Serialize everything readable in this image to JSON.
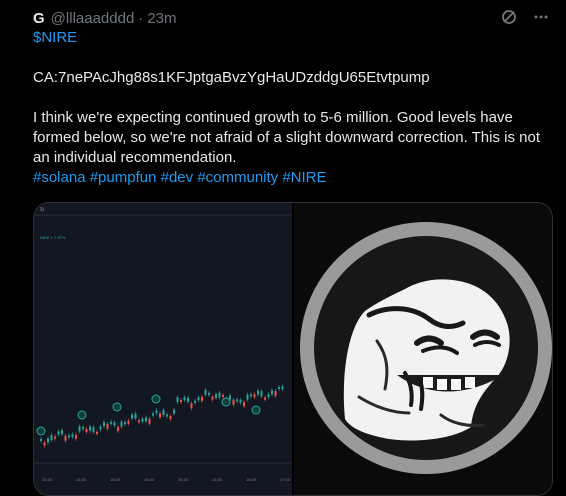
{
  "post": {
    "author": "G",
    "handle": "@lllaaadddd",
    "separator": "·",
    "time": "23m",
    "ticker": "$NIRE",
    "contract": "CA:7nePAcJhg88s1KFJptgaBvzYgHaUDzddgU65Etvtpump",
    "body": "I think we're expecting continued growth to 5-6 million. Good levels have formed below, so we're not afraid of a slight downward correction. This is not an individual recommendation.",
    "hashtags": [
      "#solana",
      "#pumpfun",
      "#dev",
      "#community",
      "#NIRE"
    ]
  },
  "actions": {
    "grok_icon": "grok-icon",
    "more_icon": "more-icon"
  },
  "media": {
    "chart_header": "$t",
    "chart_price": "NIRE 1.7 4T%",
    "chart_times": [
      "15:15",
      "15:30",
      "15:45",
      "16:00",
      "16:15",
      "16:30",
      "16:45",
      "17:00"
    ],
    "chart_colors": {
      "up": "#26a69a",
      "down": "#ef5350",
      "bg": "#131722"
    },
    "image": "grinning creature medallion"
  }
}
